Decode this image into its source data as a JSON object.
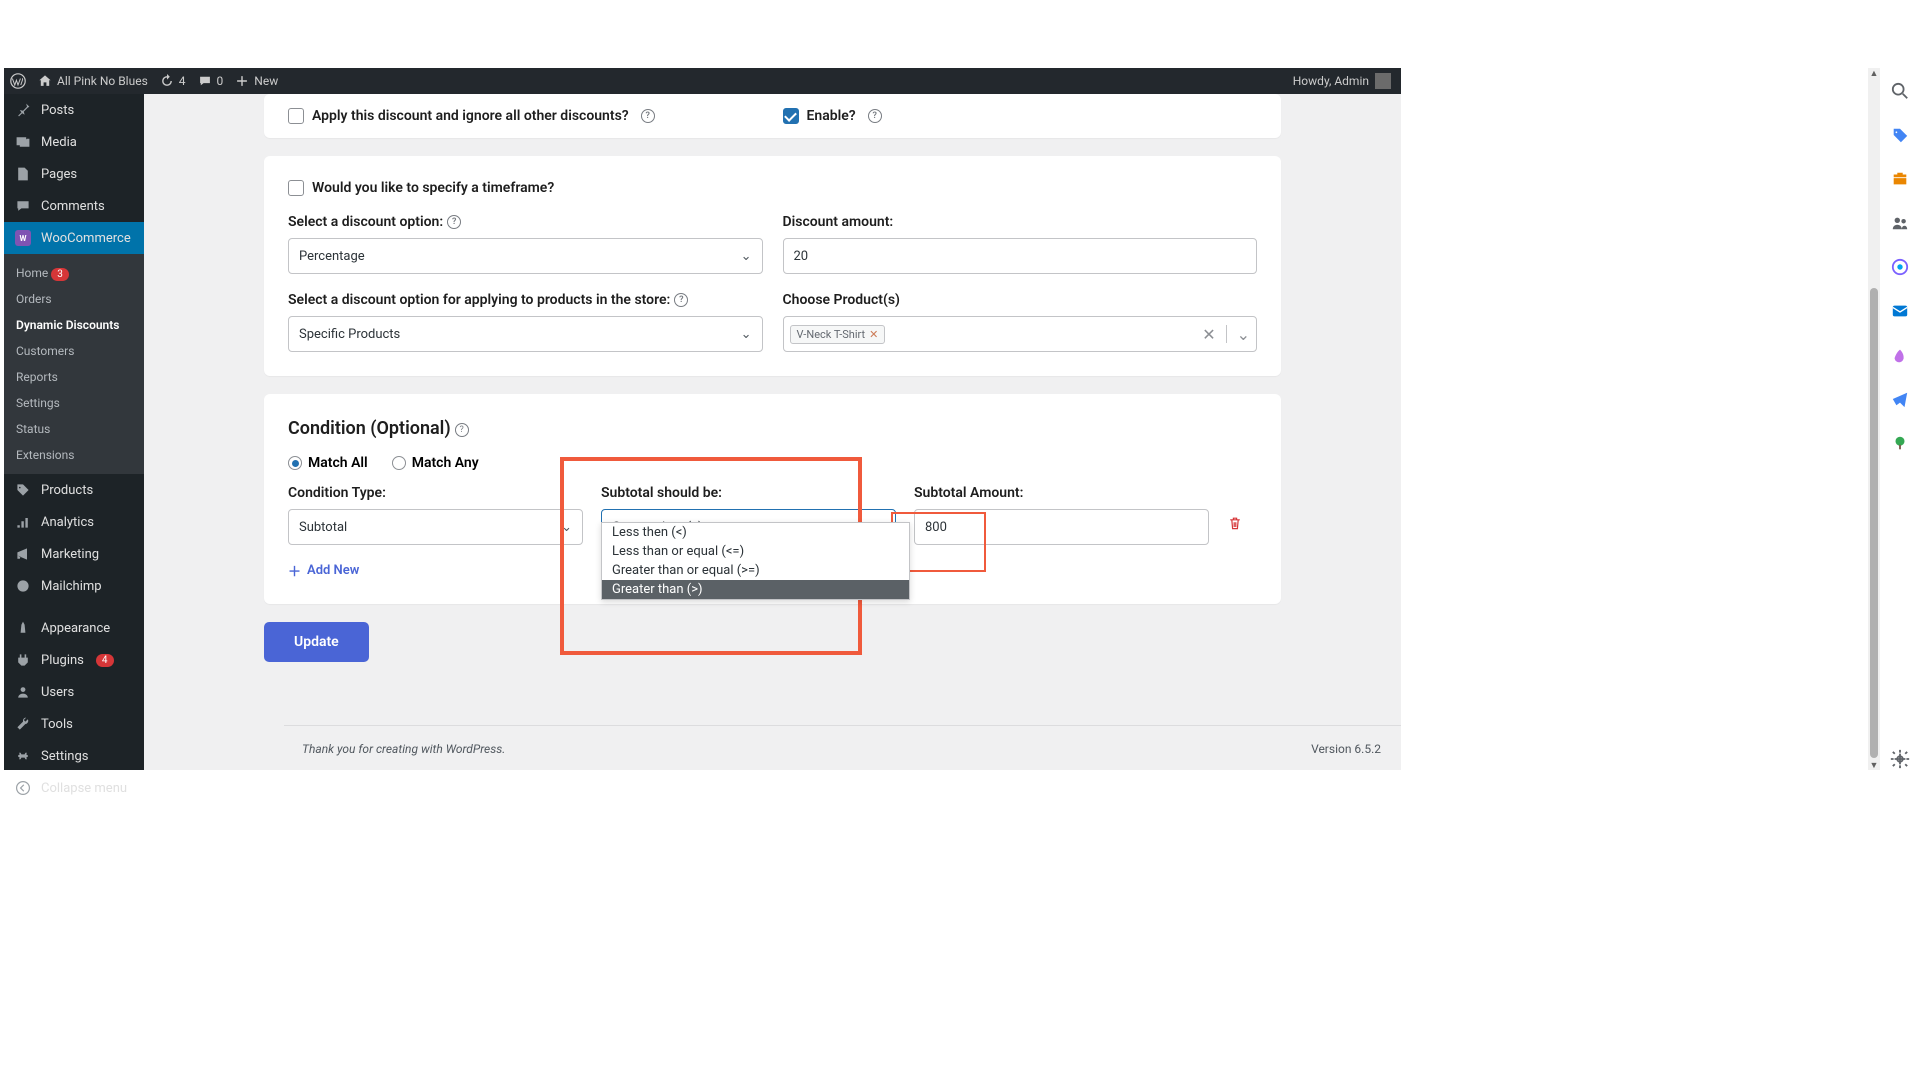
{
  "topbar": {
    "site_name": "All Pink No Blues",
    "refresh_count": "4",
    "comment_count": "0",
    "new_label": "New",
    "howdy": "Howdy, Admin"
  },
  "sidebar": {
    "posts": "Posts",
    "media": "Media",
    "pages": "Pages",
    "comments": "Comments",
    "woocommerce": "WooCommerce",
    "sub": {
      "home": "Home",
      "home_badge": "3",
      "orders": "Orders",
      "dynamic": "Dynamic Discounts",
      "customers": "Customers",
      "reports": "Reports",
      "settings": "Settings",
      "status": "Status",
      "extensions": "Extensions"
    },
    "products": "Products",
    "analytics": "Analytics",
    "marketing": "Marketing",
    "mailchimp": "Mailchimp",
    "appearance": "Appearance",
    "plugins": "Plugins",
    "plugins_badge": "4",
    "users": "Users",
    "tools": "Tools",
    "settings": "Settings",
    "collapse": "Collapse menu"
  },
  "card1": {
    "apply_ignore": "Apply this discount and ignore all other discounts?",
    "enable": "Enable?"
  },
  "card2": {
    "timeframe": "Would you like to specify a timeframe?",
    "select_discount": "Select a discount option:",
    "discount_value": "Percentage",
    "discount_amount_label": "Discount amount:",
    "discount_amount": "20",
    "apply_to_label": "Select a discount option for applying to products in the store:",
    "apply_to_value": "Specific Products",
    "choose_products": "Choose Product(s)",
    "product_tag": "V-Neck T-Shirt"
  },
  "card3": {
    "title": "Condition (Optional)",
    "match_all": "Match All",
    "match_any": "Match Any",
    "cond_type_label": "Condition Type:",
    "cond_type_value": "Subtotal",
    "subtotal_should_label": "Subtotal should be:",
    "subtotal_should_value": "Greater than (>)",
    "dd_opts": {
      "lt": "Less then (<)",
      "lte": "Less than or equal (<=)",
      "gte": "Greater than or equal (>=)",
      "gt": "Greater than (>)"
    },
    "subtotal_amount_label": "Subtotal Amount:",
    "subtotal_amount": "800",
    "add_new": "Add New"
  },
  "update": "Update",
  "footer": {
    "thanks": "Thank you for creating with WordPress.",
    "version": "Version 6.5.2"
  }
}
